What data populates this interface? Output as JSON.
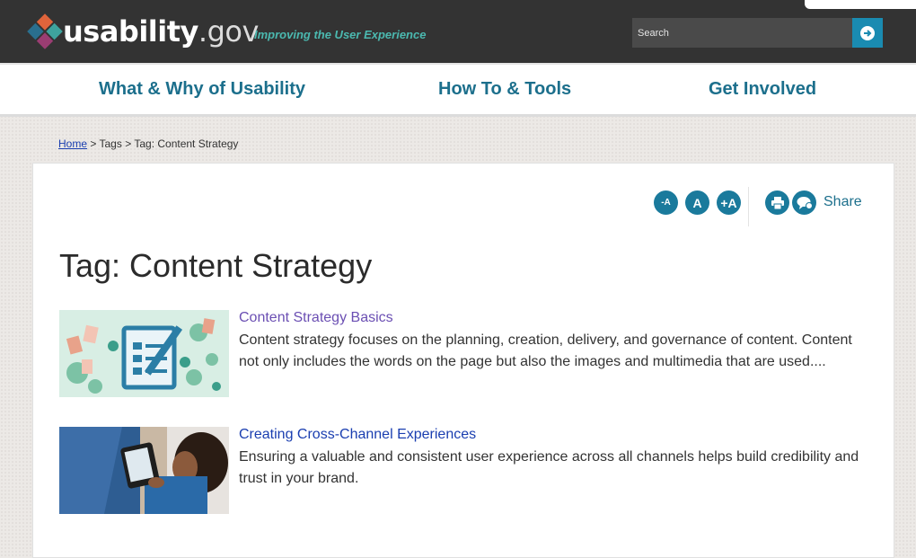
{
  "header": {
    "logo_bold": "usability",
    "logo_light": ".gov",
    "tagline": "Improving the User Experience",
    "search_placeholder": "Search",
    "search_icon": "arrow-right-circle-icon",
    "bg_color": "#333333",
    "accent_color": "#1a8bb1"
  },
  "nav": {
    "items": [
      {
        "label": "What & Why of Usability"
      },
      {
        "label": "How To & Tools"
      },
      {
        "label": "Get Involved"
      }
    ],
    "link_color": "#1c6f8c"
  },
  "breadcrumb": {
    "home": "Home",
    "sep1": ">",
    "tags": "Tags",
    "sep2": ">",
    "current": "Tag: Content Strategy"
  },
  "tools": {
    "decrease_label": "-A",
    "normal_label": "A",
    "increase_label": "+A",
    "print_icon": "print-icon",
    "share_icon": "share-speech-bubble-icon",
    "share_label": "Share"
  },
  "main": {
    "title": "Tag: Content Strategy",
    "items": [
      {
        "title": "Content Strategy Basics",
        "title_color": "#6b4fb3",
        "description": "Content strategy focuses on the planning, creation, delivery, and governance of content.  Content not only includes the words on the page but also the images and multimedia that are used....",
        "thumbnail": "content-strategy-illustration"
      },
      {
        "title": "Creating Cross-Channel Experiences",
        "title_color": "#1a3eb0",
        "description": "Ensuring a valuable and consistent user experience across all channels helps build credibility and trust in your brand.",
        "thumbnail": "person-using-tablet-photo"
      }
    ]
  }
}
